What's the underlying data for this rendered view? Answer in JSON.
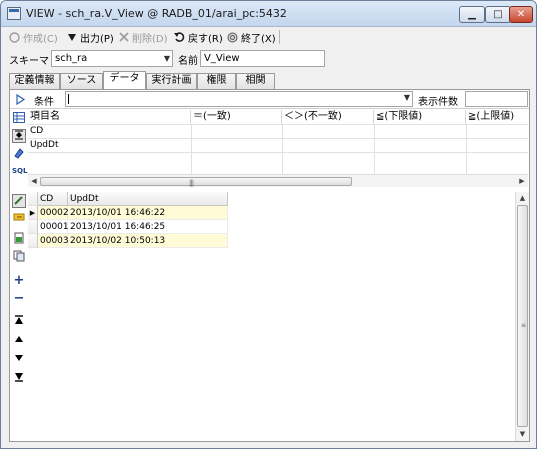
{
  "window": {
    "title": "VIEW - sch_ra.V_View @ RADB_01/arai_pc:5432",
    "minimize": "▁",
    "maximize": "□",
    "close": "✕"
  },
  "toolbar": {
    "create": "作成(C)",
    "output": "出力(P)",
    "delete": "削除(D)",
    "back": "戻す(R)",
    "exit": "終了(X)"
  },
  "schema": {
    "label": "スキーマ",
    "value": "sch_ra",
    "name_label": "名前",
    "name_value": "V_View"
  },
  "tabs": [
    {
      "label": "定義情報",
      "active": false
    },
    {
      "label": "ソース",
      "active": false
    },
    {
      "label": "データ",
      "active": true
    },
    {
      "label": "実行計画",
      "active": false
    },
    {
      "label": "権限",
      "active": false
    },
    {
      "label": "相関",
      "active": false
    }
  ],
  "condition": {
    "label": "条件",
    "value": "",
    "count_label": "表示件数",
    "count_value": ""
  },
  "condition_grid": {
    "headers": [
      "項目名",
      "＝(一致)",
      "＜＞(不一致)",
      "≦(下限値)",
      "≧(上限値)"
    ],
    "rows": [
      "CD",
      "UpdDt"
    ]
  },
  "data_grid": {
    "headers": [
      "CD",
      "UpdDt"
    ],
    "rows": [
      {
        "cd": "00002",
        "upddt": "2013/10/01  16:46:22",
        "current": true
      },
      {
        "cd": "00001",
        "upddt": "2013/10/01  16:46:25",
        "current": false
      },
      {
        "cd": "00003",
        "upddt": "2013/10/02  10:50:13",
        "current": false
      }
    ]
  },
  "colors": {
    "highlight_row": "#fffbd6",
    "title_gradient_top": "#dbe8f7",
    "close_button": "#c6452c"
  }
}
